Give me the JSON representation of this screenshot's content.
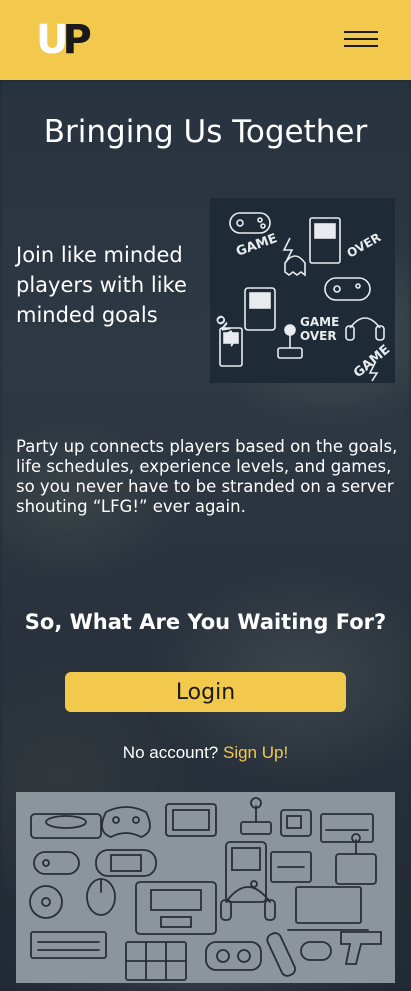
{
  "header": {
    "logo": {
      "letter_u": "U",
      "letter_p": "P"
    },
    "menu_icon": "hamburger-menu-icon",
    "background_color": "#f2c94c"
  },
  "main": {
    "title": "Bringing Us Together",
    "tagline": "Join like minded players with like minded goals",
    "hero_image_icon": "retro-gaming-pattern-image",
    "description": "Party up connects players based on the goals, life schedules, experience levels, and games, so you never have to be stranded on a server shouting “LFG!” ever again.",
    "cta_heading": "So, What Are You Waiting For?",
    "login_label": "Login",
    "signup_prompt": "No account?",
    "signup_link": "Sign Up!",
    "footer_image_icon": "gaming-devices-doodle-image"
  },
  "colors": {
    "accent": "#f2c94c",
    "text": "#ffffff",
    "dark": "#1a1a1a"
  }
}
